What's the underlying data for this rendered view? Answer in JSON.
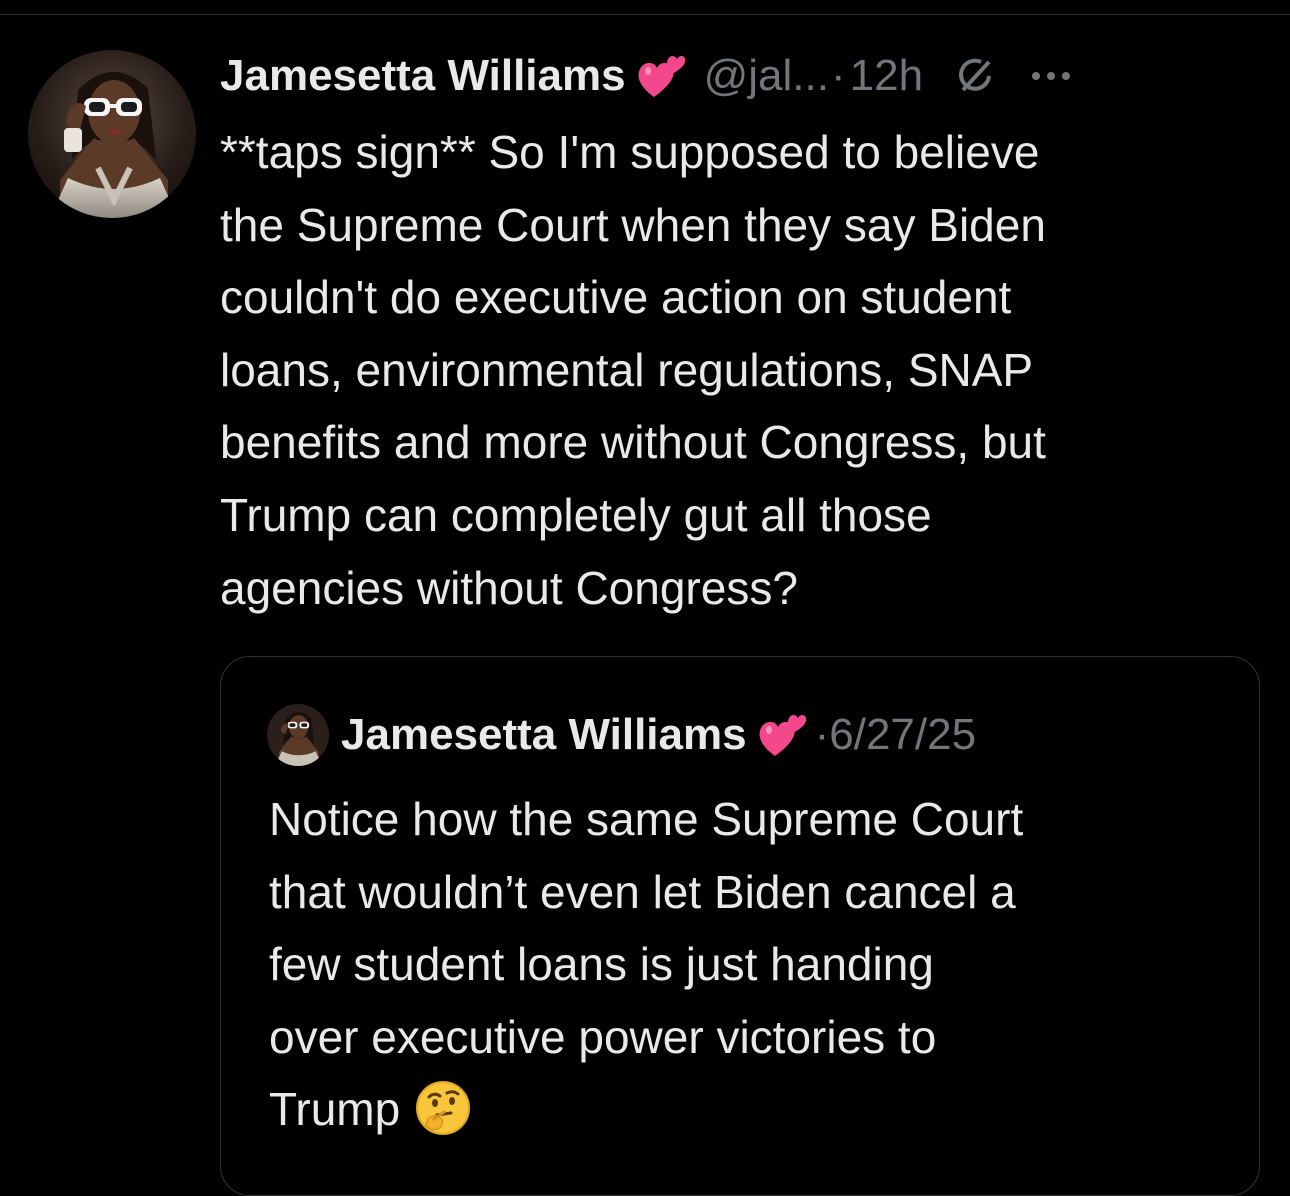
{
  "tweet": {
    "author_name": "Jamesetta Williams",
    "author_handle": "@jal...",
    "separator": "·",
    "timestamp": "12h",
    "text_lines": [
      "**taps sign** So I'm supposed to believe",
      "the Supreme Court when they say Biden",
      "couldn't do executive action on student",
      "loans, environmental regulations, SNAP",
      "benefits and more without Congress, but",
      "Trump can completely gut all those",
      "agencies without Congress?"
    ]
  },
  "quote": {
    "author_name": "Jamesetta Williams",
    "separator": "·",
    "date": "6/27/25",
    "text_lines": [
      "Notice how the same Supreme Court",
      "that wouldn’t even let Biden cancel a",
      "few student loans is just handing",
      "over executive power victories to",
      "Trump"
    ]
  },
  "icons": {
    "badge": "two-hearts-icon",
    "grok": "grok-icon",
    "more": "more-options-icon",
    "emoji_end": "thinking-face-icon"
  },
  "colors": {
    "background": "#000000",
    "text": "#e7e9ea",
    "muted": "#71767b",
    "border": "#2f3336",
    "heart_pink": "#f4488c"
  }
}
